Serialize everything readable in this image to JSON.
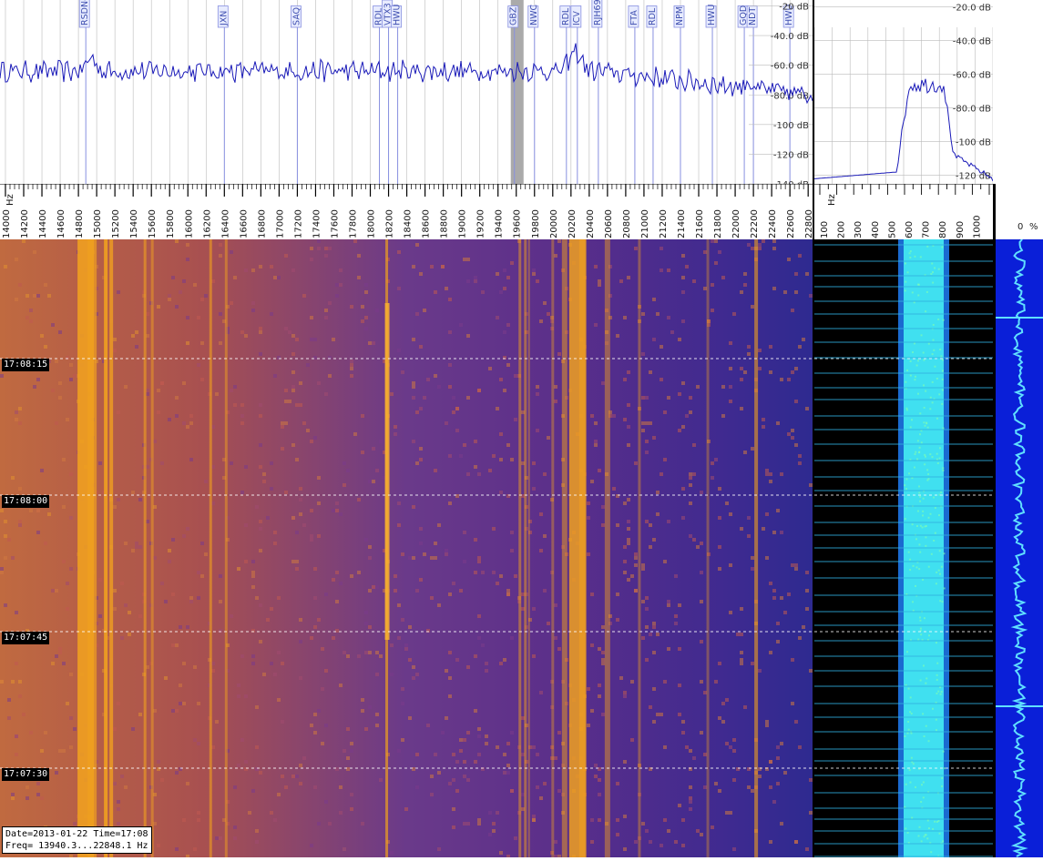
{
  "main_spectrum": {
    "db_labels": [
      "-20 dB",
      "-40.0 dB",
      "-60.0 dB",
      "-80.0 dB",
      "-100 dB",
      "-120 dB",
      "-140 dB"
    ],
    "stations": [
      {
        "name": "RSDN-3",
        "freq": 14881
      },
      {
        "name": "JXN",
        "freq": 16400
      },
      {
        "name": "SAQ",
        "freq": 17200
      },
      {
        "name": "RDL",
        "freq": 18100
      },
      {
        "name": "VTX3",
        "freq": 18200
      },
      {
        "name": "HWU",
        "freq": 18300
      },
      {
        "name": "GBZ",
        "freq": 19580
      },
      {
        "name": "NWC",
        "freq": 19800
      },
      {
        "name": "RDL",
        "freq": 20150
      },
      {
        "name": "ICV",
        "freq": 20270
      },
      {
        "name": "RJH69",
        "freq": 20500
      },
      {
        "name": "FTA",
        "freq": 20900
      },
      {
        "name": "RDL",
        "freq": 21100
      },
      {
        "name": "NPM",
        "freq": 21400
      },
      {
        "name": "HWU",
        "freq": 21750
      },
      {
        "name": "GQD",
        "freq": 22100
      },
      {
        "name": "NDT",
        "freq": 22200
      },
      {
        "name": "HWU",
        "freq": 22600
      }
    ],
    "freq_min": 13940.3,
    "freq_max": 22848.1,
    "db_min": -140,
    "db_max": -16
  },
  "side_spectrum": {
    "db_labels": [
      "-20.0 dB",
      "-40.0 dB",
      "-60.0 dB",
      "-80.0 dB",
      "-100 dB",
      "-120 dB"
    ]
  },
  "main_axis": {
    "unit": "Hz",
    "labels": [
      "14000",
      "14200",
      "14400",
      "14600",
      "14800",
      "15000",
      "15200",
      "15400",
      "15600",
      "15800",
      "16000",
      "16200",
      "16400",
      "16600",
      "16800",
      "17000",
      "17200",
      "17400",
      "17600",
      "17800",
      "18000",
      "18200",
      "18400",
      "18600",
      "18800",
      "19000",
      "19200",
      "19400",
      "19600",
      "19800",
      "20000",
      "20200",
      "20400",
      "20600",
      "20800",
      "21000",
      "21200",
      "21400",
      "21600",
      "21800",
      "22000",
      "22200",
      "22400",
      "22600",
      "22800"
    ]
  },
  "side_axis": {
    "unit": "Hz",
    "labels": [
      "100",
      "200",
      "300",
      "400",
      "500",
      "600",
      "700",
      "800",
      "900",
      "1000"
    ]
  },
  "pct_axis": {
    "zero": "0",
    "unit": "%"
  },
  "time_labels": [
    "17:08:15",
    "17:08:00",
    "17:07:45",
    "17:07:30"
  ],
  "info": {
    "line1": "Date=2013-01-22 Time=17:08",
    "line2": "Freq= 13940.3...22848.1 Hz"
  },
  "colors": {
    "spectrum_line": "#1a1ab8",
    "marker_line": "#8890e0",
    "grid": "#bbbbbb",
    "waterfall_bg": "#3a1a6e",
    "waterfall_hot": "#f0a020",
    "side_waterfall_band": "#40e0f0",
    "pct_bg": "#0a1fd8"
  }
}
